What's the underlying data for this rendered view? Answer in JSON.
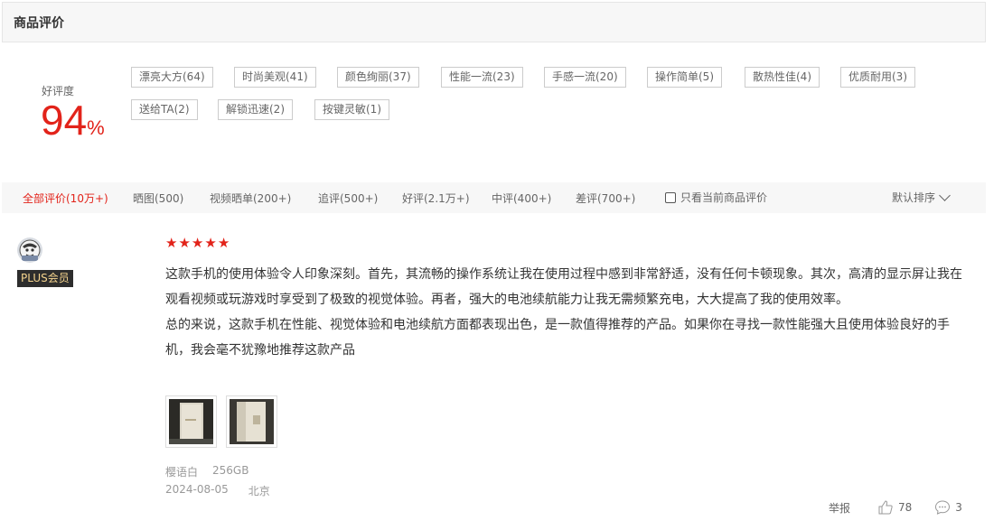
{
  "header": {
    "title": "商品评价"
  },
  "rating": {
    "label": "好评度",
    "value": "94",
    "unit": "%"
  },
  "tags": [
    "漂亮大方(64)",
    "时尚美观(41)",
    "颜色绚丽(37)",
    "性能一流(23)",
    "手感一流(20)",
    "操作简单(5)",
    "散热性佳(4)",
    "优质耐用(3)",
    "送给TA(2)",
    "解锁迅速(2)",
    "按键灵敏(1)"
  ],
  "filters": [
    {
      "label": "全部评价(10万+)",
      "active": true
    },
    {
      "label": "晒图(500)"
    },
    {
      "label": "视频晒单(200+)"
    },
    {
      "label": "追评(500+)"
    },
    {
      "label": "好评(2.1万+)"
    },
    {
      "label": "中评(400+)"
    },
    {
      "label": "差评(700+)"
    }
  ],
  "only_current": {
    "label": "只看当前商品评价",
    "checked": false
  },
  "sort": {
    "label": "默认排序"
  },
  "review": {
    "badge": "PLUS会员",
    "stars": 5,
    "paragraphs": [
      "这款手机的使用体验令人印象深刻。首先，其流畅的操作系统让我在使用过程中感到非常舒适，没有任何卡顿现象。其次，高清的显示屏让我在观看视频或玩游戏时享受到了极致的视觉体验。再者，强大的电池续航能力让我无需频繁充电，大大提高了我的使用效率。",
      "总的来说，这款手机在性能、视觉体验和电池续航方面都表现出色，是一款值得推荐的产品。如果你在寻找一款性能强大且使用体验良好的手机，我会毫不犹豫地推荐这款产品"
    ],
    "variant_color": "樱语白",
    "variant_storage": "256GB",
    "date": "2024-08-05",
    "location": "北京",
    "report": "举报",
    "likes": "78",
    "comments": "3"
  },
  "colors": {
    "accent": "#e2231a"
  }
}
